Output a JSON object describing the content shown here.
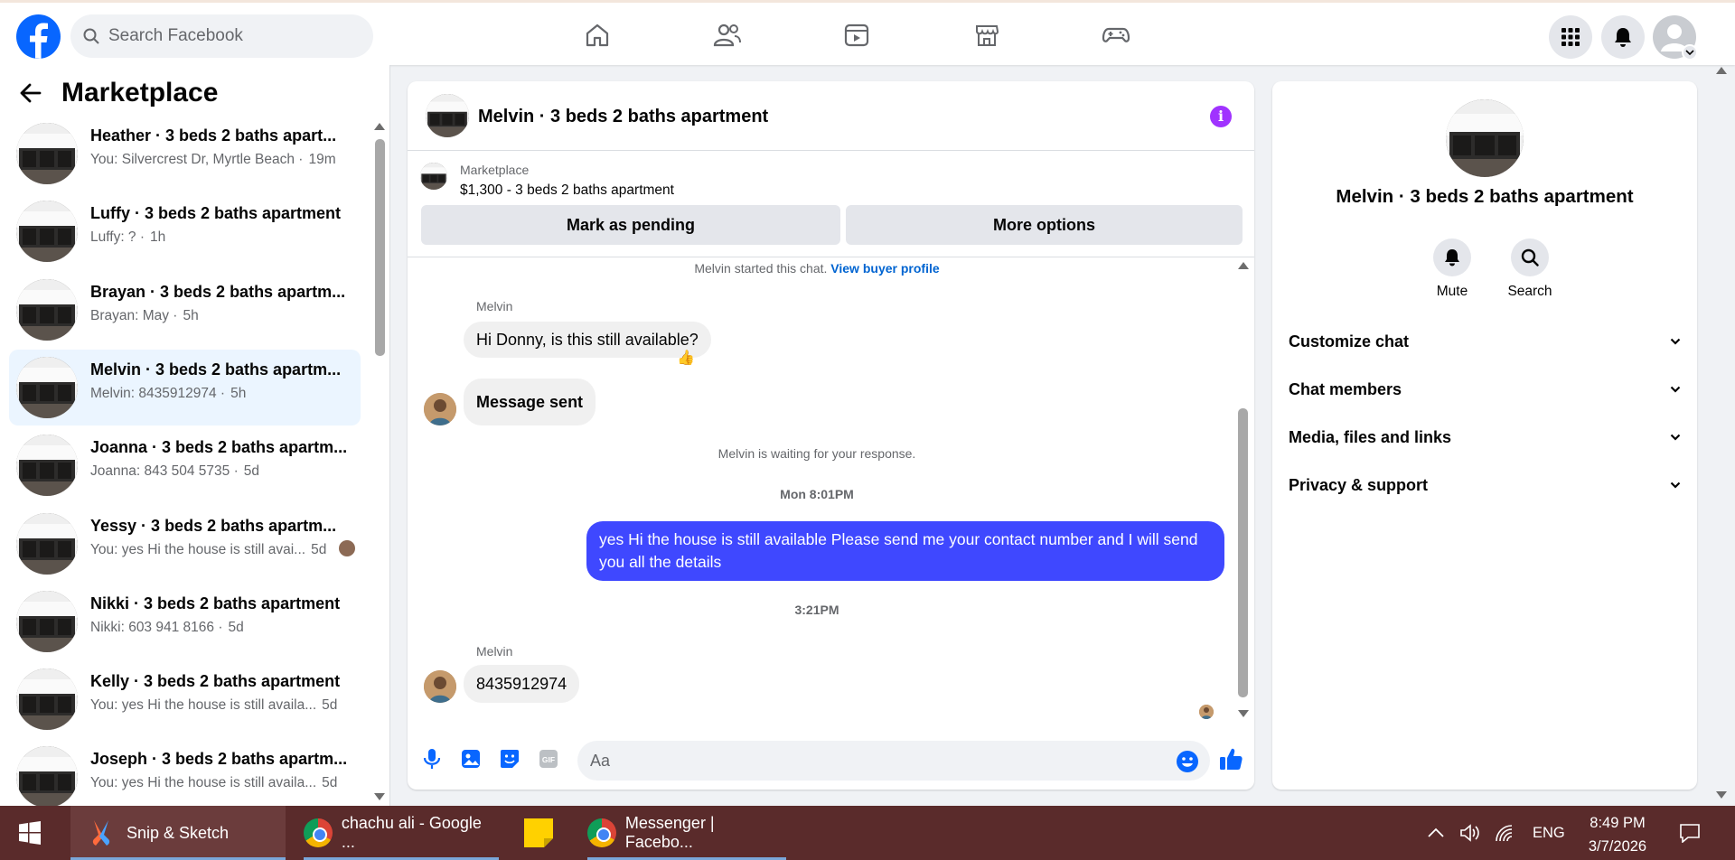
{
  "topbar": {
    "search_placeholder": "Search Facebook",
    "nav_icons": [
      "home-icon",
      "friends-icon",
      "video-icon",
      "marketplace-icon",
      "gaming-icon"
    ],
    "right_icons": [
      "menu-grid-icon",
      "notifications-bell-icon",
      "account-avatar"
    ]
  },
  "sidebar": {
    "title": "Marketplace",
    "conversations": [
      {
        "name": "Heather · 3 beds 2 baths apart...",
        "preview": "You: Silvercrest Dr, Myrtle Beach ·",
        "time": "19m"
      },
      {
        "name": "Luffy · 3 beds 2 baths apartment",
        "preview": "Luffy: ? ·",
        "time": "1h"
      },
      {
        "name": "Brayan · 3 beds 2 baths apartm...",
        "preview": "Brayan: May ·",
        "time": "5h"
      },
      {
        "name": "Melvin · 3 beds 2 baths apartm...",
        "preview": "Melvin: 8435912974 ·",
        "time": "5h"
      },
      {
        "name": "Joanna · 3 beds 2 baths apartm...",
        "preview": "Joanna: 843 504 5735 ·",
        "time": "5d"
      },
      {
        "name": "Yessy · 3 beds 2 baths apartm...",
        "preview": "You: yes Hi the house is still avai...",
        "time": "5d"
      },
      {
        "name": "Nikki · 3 beds 2 baths apartment",
        "preview": "Nikki: 603 941 8166 ·",
        "time": "5d"
      },
      {
        "name": "Kelly · 3 beds 2 baths apartment",
        "preview": "You: yes Hi the house is still availa...",
        "time": "5d"
      },
      {
        "name": "Joseph · 3 beds 2 baths apartm...",
        "preview": "You: yes Hi the house is still availa...",
        "time": "5d"
      }
    ]
  },
  "chat": {
    "title": "Melvin · 3 beds 2 baths apartment",
    "listing_label": "Marketplace",
    "listing_price": "$1,300 - 3 beds 2 baths apartment",
    "mark_pending": "Mark as pending",
    "more_options": "More options",
    "started_text": "Melvin started this chat.",
    "view_buyer": "View buyer profile",
    "sender": "Melvin",
    "msg1": "Hi Donny, is this still available?",
    "reaction": "👍",
    "msg2": "Message sent",
    "waiting": "Melvin is waiting for your response.",
    "date1": "Mon 8:01PM",
    "msg3": "yes Hi the house is still available Please send me your contact number and I will send you all the details",
    "date2": "3:21PM",
    "sender2": "Melvin",
    "msg4": "8435912974",
    "input_placeholder": "Aa"
  },
  "details": {
    "title": "Melvin · 3 beds 2 baths apartment",
    "mute": "Mute",
    "search": "Search",
    "sections": [
      "Customize chat",
      "Chat members",
      "Media, files and links",
      "Privacy & support"
    ]
  },
  "taskbar": {
    "snip": "Snip & Sketch",
    "chrome1": "chachu ali - Google ...",
    "chrome2": "Messenger | Facebo...",
    "lang": "ENG",
    "time": "8:49 PM",
    "date": "3/7/2026"
  }
}
